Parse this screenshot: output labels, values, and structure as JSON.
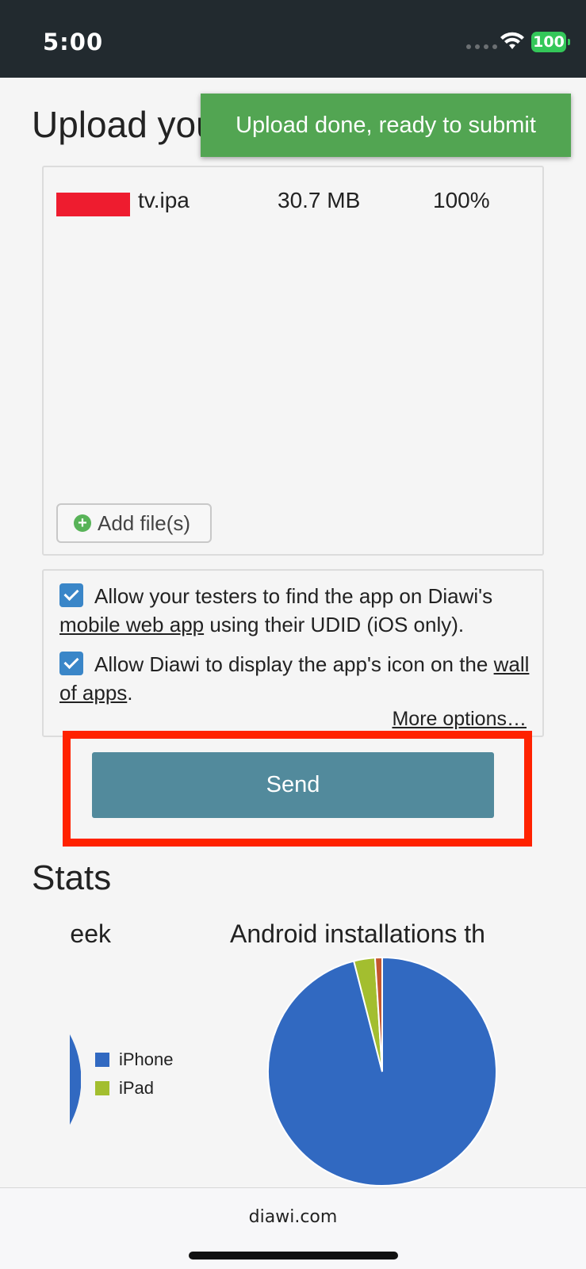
{
  "status_bar": {
    "time": "5:00",
    "battery": "100"
  },
  "page": {
    "title": "Upload your app"
  },
  "toast": {
    "message": "Upload done, ready to submit"
  },
  "file_list": {
    "files": [
      {
        "name": "tv.ipa",
        "size": "30.7 MB",
        "progress": "100%"
      }
    ],
    "add_button_label": "Add file(s)"
  },
  "options": {
    "option1": {
      "text_before": "Allow your testers to find the app on Diawi's",
      "link": "mobile web app",
      "text_after": "using their UDID (iOS only).",
      "checked": true
    },
    "option2": {
      "text_before": "Allow Diawi to display the app's icon on the",
      "link": "wall of apps",
      "text_after": ".",
      "checked": true
    },
    "more_options": "More options…"
  },
  "send_button": {
    "label": "Send",
    "color": "#528a9c"
  },
  "highlight_color": "#ff2200",
  "stats": {
    "title": "Stats",
    "left_chart_title_fragment": "eek",
    "right_chart_title_fragment": "Android installations th",
    "legend": [
      {
        "label": "iPhone",
        "color": "#3169c1"
      },
      {
        "label": "iPad",
        "color": "#a3be2f"
      }
    ]
  },
  "chart_data": {
    "type": "pie",
    "title": "Android installations th",
    "slices": [
      {
        "color": "#3169c1",
        "value": 96
      },
      {
        "color": "#a3be2f",
        "value": 3
      },
      {
        "color": "#c4572e",
        "value": 1
      }
    ]
  },
  "browser": {
    "url": "diawi.com"
  }
}
